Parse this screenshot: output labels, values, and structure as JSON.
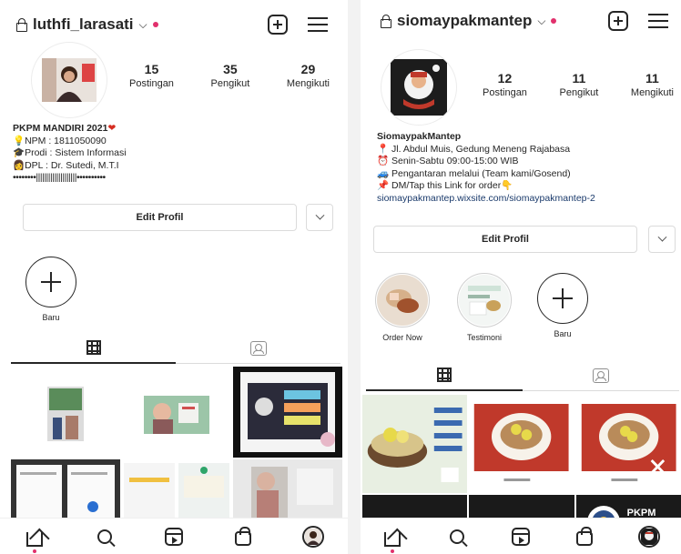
{
  "left": {
    "username": "luthfi_larasati",
    "stats": [
      {
        "count": "15",
        "label": "Postingan"
      },
      {
        "count": "35",
        "label": "Pengikut"
      },
      {
        "count": "29",
        "label": "Mengikuti"
      }
    ],
    "bio": {
      "name": "PKPM MANDIRI 2021",
      "lines": [
        "💡NPM  : 1811050090",
        "🎓Prodi : Sistem Informasi",
        "👩DPL   : Dr. Sutedi, M.T.I",
        "••••••••||||||||||||||||||||••••••••••"
      ]
    },
    "edit_label": "Edit Profil",
    "highlight_new_label": "Baru"
  },
  "right": {
    "username": "siomaypakmantep",
    "stats": [
      {
        "count": "12",
        "label": "Postingan"
      },
      {
        "count": "11",
        "label": "Pengikut"
      },
      {
        "count": "11",
        "label": "Mengikuti"
      }
    ],
    "bio": {
      "name": "SiomaypakMantep",
      "lines": [
        "📍 Jl. Abdul Muis, Gedung Meneng Rajabasa",
        "⏰ Senin-Sabtu 09:00-15:00 WIB",
        "🚙 Pengantaran melalui (Team kami/Gosend)",
        "📌 DM/Tap this Link for order👇"
      ],
      "link": "siomaypakmantep.wixsite.com/siomaypakmantep-2"
    },
    "edit_label": "Edit Profil",
    "highlights": [
      {
        "label": "Order Now"
      },
      {
        "label": "Testimoni"
      },
      {
        "label": "Baru"
      }
    ],
    "grid_partial_label": "PKPM"
  },
  "colors": {
    "text": "#262626",
    "notification": "#e1306c",
    "link": "#1a3a6b",
    "border": "#dbdbdb"
  }
}
